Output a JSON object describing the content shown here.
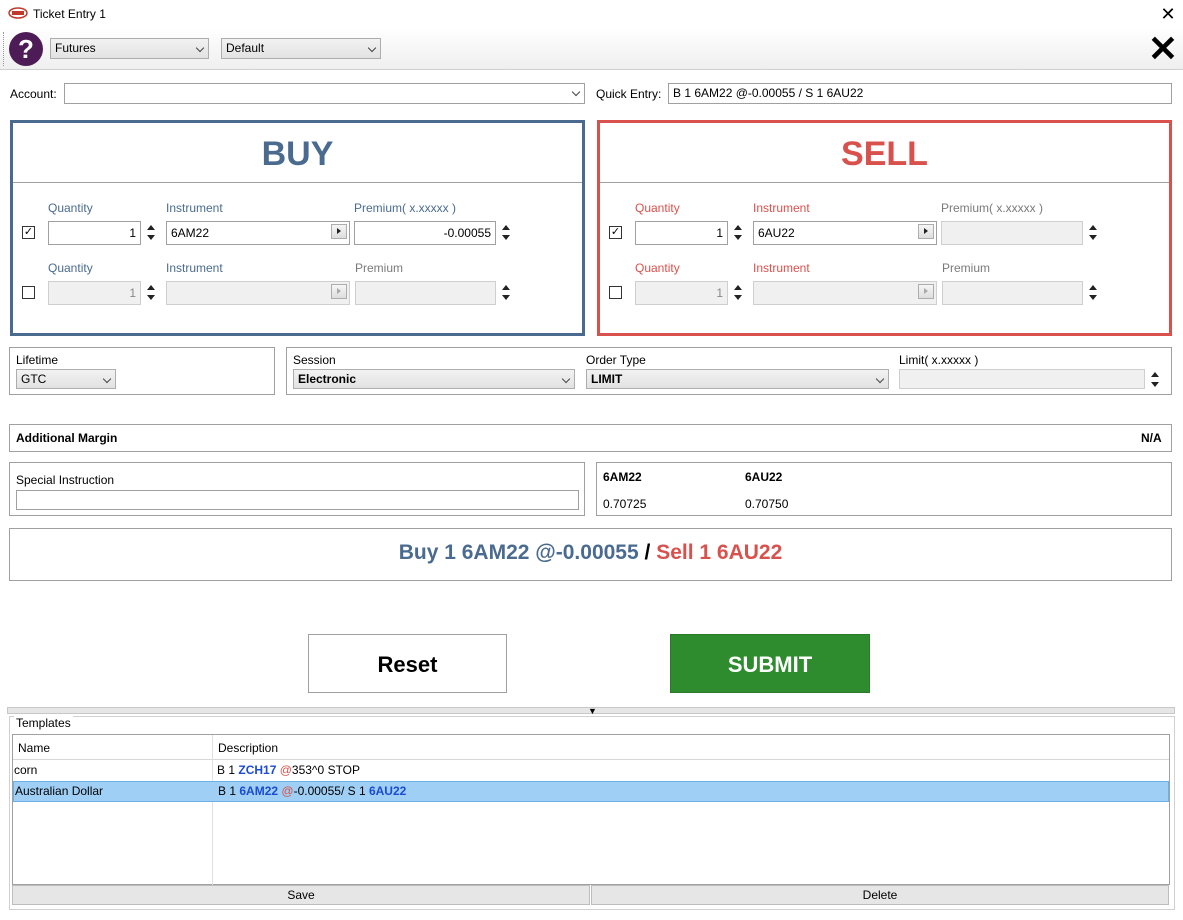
{
  "window": {
    "title": "Ticket Entry 1",
    "app_icon": "qst-logo-icon",
    "close_glyph": "✕"
  },
  "toolbar": {
    "help_glyph": "?",
    "product_type": "Futures",
    "layout": "Default",
    "close_glyph": "✕"
  },
  "account": {
    "label": "Account:",
    "value": ""
  },
  "quick_entry": {
    "label": "Quick Entry:",
    "value": "B 1 6AM22 @-0.00055 / S 1 6AU22"
  },
  "buy": {
    "title": "BUY",
    "color": "#4a6b8f",
    "legs": [
      {
        "checked": true,
        "check_glyph": "✓",
        "quantity_label": "Quantity",
        "quantity": "1",
        "instrument_label": "Instrument",
        "instrument": "6AM22",
        "premium_label": "Premium( x.xxxxx )",
        "premium": "-0.00055"
      },
      {
        "checked": false,
        "check_glyph": "",
        "quantity_label": "Quantity",
        "quantity": "1",
        "instrument_label": "Instrument",
        "instrument": "",
        "premium_label": "Premium",
        "premium": ""
      }
    ]
  },
  "sell": {
    "title": "SELL",
    "color": "#d9514d",
    "legs": [
      {
        "checked": true,
        "check_glyph": "✓",
        "quantity_label": "Quantity",
        "quantity": "1",
        "instrument_label": "Instrument",
        "instrument": "6AU22",
        "premium_label": "Premium( x.xxxxx )",
        "premium": ""
      },
      {
        "checked": false,
        "check_glyph": "",
        "quantity_label": "Quantity",
        "quantity": "1",
        "instrument_label": "Instrument",
        "instrument": "",
        "premium_label": "Premium",
        "premium": ""
      }
    ]
  },
  "order": {
    "lifetime_label": "Lifetime",
    "lifetime": "GTC",
    "session_label": "Session",
    "session": "Electronic",
    "order_type_label": "Order Type",
    "order_type": "LIMIT",
    "limit_label": "Limit( x.xxxxx )",
    "limit": ""
  },
  "margin": {
    "label": "Additional Margin",
    "value": "N/A"
  },
  "special_instruction": {
    "label": "Special Instruction",
    "value": ""
  },
  "prices": [
    {
      "instrument": "6AM22",
      "price": "0.70725"
    },
    {
      "instrument": "6AU22",
      "price": "0.70750"
    }
  ],
  "summary": {
    "buy_text": "Buy 1 6AM22 @-0.00055",
    "separator": " / ",
    "sell_text": "Sell 1 6AU22"
  },
  "actions": {
    "reset": "Reset",
    "submit": "SUBMIT",
    "submit_color": "#2e8b2e"
  },
  "templates": {
    "title": "Templates",
    "columns": [
      "Name",
      "Description"
    ],
    "rows": [
      {
        "name": "corn",
        "desc_prefix": "B 1 ",
        "desc_inst1": "ZCH17",
        "desc_at": "@",
        "desc_rest": "353^0 STOP",
        "desc_inst2": "",
        "selected": false
      },
      {
        "name": "Australian Dollar",
        "desc_prefix": "B 1 ",
        "desc_inst1": "6AM22",
        "desc_at": "@",
        "desc_rest": "-0.00055/ S 1 ",
        "desc_inst2": "6AU22",
        "selected": true
      }
    ],
    "save": "Save",
    "delete": "Delete"
  }
}
